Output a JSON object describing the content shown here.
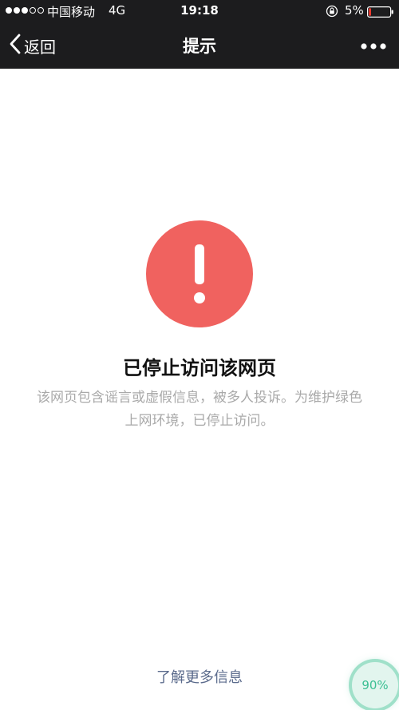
{
  "status_bar": {
    "carrier": "中国移动",
    "network": "4G",
    "time": "19:18",
    "battery": "5%",
    "signal_full_dots": 3,
    "signal_empty_dots": 2
  },
  "nav": {
    "back_label": "返回",
    "title": "提示"
  },
  "main": {
    "title": "已停止访问该网页",
    "description_line1": "该网页包含谣言或虚假信息，被多人投诉。为维护绿色",
    "description_line2": "上网环境，已停止访问。",
    "learn_more": "了解更多信息"
  },
  "badge": {
    "progress": "90%"
  },
  "colors": {
    "bar_background": "#1c1c1e",
    "warning_red": "#f0625f",
    "link_color": "#5b6b8c",
    "badge_green": "#3bbf93"
  },
  "icons": {
    "back": "chevron-left-icon",
    "more": "more-dots-icon",
    "warning": "exclamation-icon",
    "lock": "rotation-lock-icon",
    "battery": "battery-icon"
  }
}
